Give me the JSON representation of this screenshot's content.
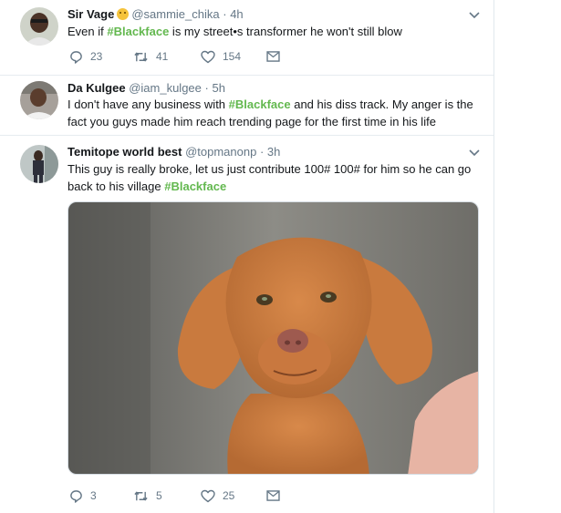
{
  "tweets": [
    {
      "name": "Sir Vage",
      "handle": "@sammie_chika",
      "dot": "·",
      "time": "4h",
      "text_before": "Even if ",
      "hashtag": "#Blackface",
      "text_after": " is my street•s transformer he won't still blow",
      "replies": "23",
      "retweets": "41",
      "likes": "154"
    },
    {
      "name": "Da Kulgee",
      "handle": "@iam_kulgee",
      "dot": "·",
      "time": "5h",
      "text_before": "I don't have any business with ",
      "hashtag": "#Blackface",
      "text_after": " and his diss track. My anger is the fact you guys made him reach trending page for the first time in his life"
    },
    {
      "name": "Temitope world best",
      "handle": "@topmanonp",
      "dot": "·",
      "time": "3h",
      "text_before": "This guy is really broke, let us just contribute 100# 100# for him so he can go back to his village ",
      "hashtag": "#Blackface",
      "text_after": "",
      "replies": "3",
      "retweets": "5",
      "likes": "25"
    }
  ],
  "icons": {
    "reply": "reply-icon",
    "retweet": "retweet-icon",
    "like": "heart-icon",
    "message": "envelope-icon",
    "menu": "chevron-down-icon"
  },
  "colors": {
    "hashtag": "#63b84f",
    "muted": "#657786",
    "text": "#14171a"
  }
}
